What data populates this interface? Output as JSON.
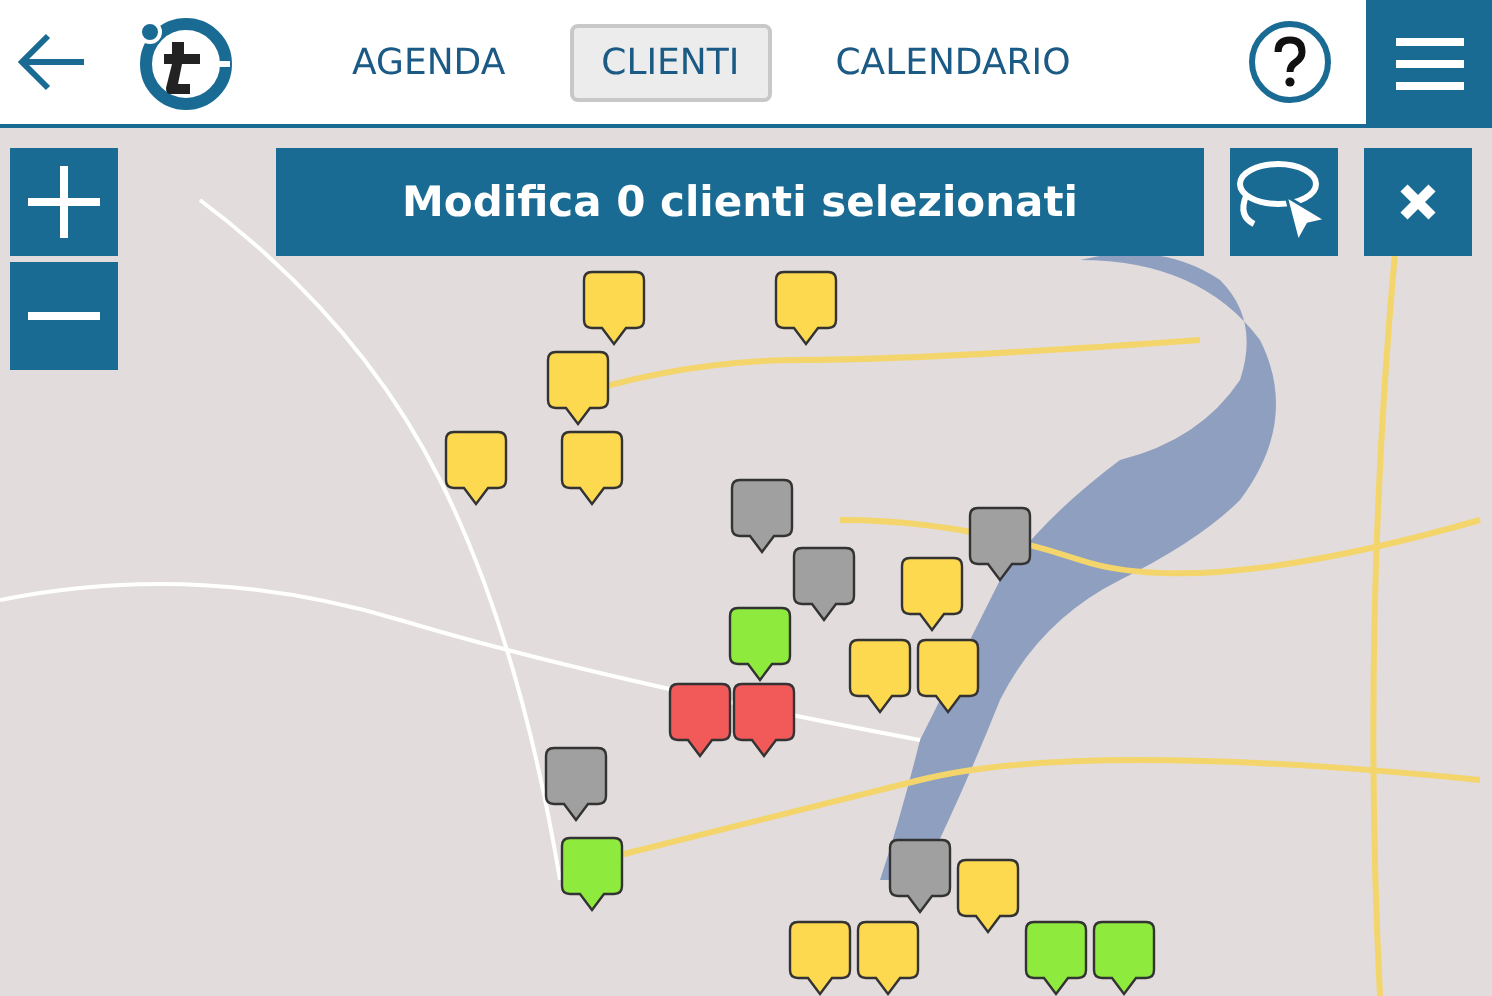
{
  "tabs": [
    {
      "label": "AGENDA",
      "selected": false
    },
    {
      "label": "CLIENTI",
      "selected": true
    },
    {
      "label": "CALENDARIO",
      "selected": false
    }
  ],
  "banner": {
    "title": "Modifica 0 clienti selezionati"
  },
  "pins": [
    {
      "color": "#fdd94f"
    },
    {
      "color": "#fdd94f"
    },
    {
      "color": "#fdd94f"
    },
    {
      "color": "#fdd94f"
    },
    {
      "color": "#fdd94f"
    },
    {
      "color": "#fdd94f"
    },
    {
      "color": "#fdd94f"
    },
    {
      "color": "#fdd94f"
    },
    {
      "color": "#fdd94f"
    },
    {
      "color": "#fdd94f"
    },
    {
      "color": "#fdd94f"
    },
    {
      "color": "#a0a0a0"
    },
    {
      "color": "#a0a0a0"
    },
    {
      "color": "#a0a0a0"
    },
    {
      "color": "#a0a0a0"
    },
    {
      "color": "#a0a0a0"
    },
    {
      "color": "#8eea3c"
    },
    {
      "color": "#8eea3c"
    },
    {
      "color": "#8eea3c"
    },
    {
      "color": "#8eea3c"
    },
    {
      "color": "#f25a5a"
    },
    {
      "color": "#f25a5a"
    }
  ]
}
